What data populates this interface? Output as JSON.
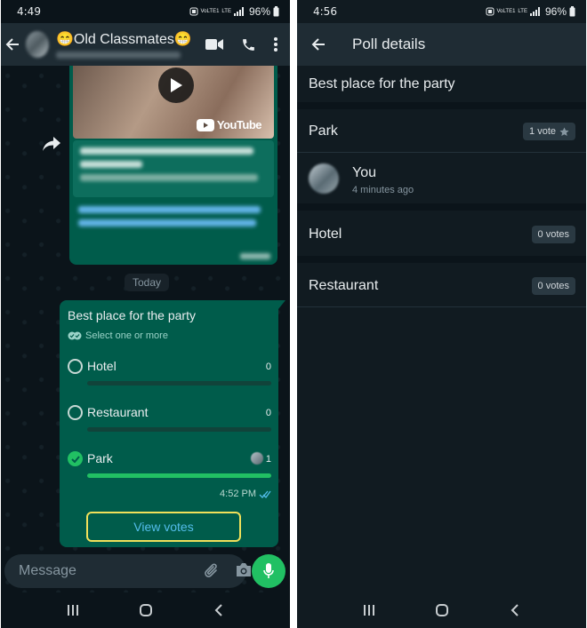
{
  "colors": {
    "accent": "#21c063",
    "bubble": "#005c4b",
    "link": "#53bdeb",
    "highlight": "#f1e05a"
  },
  "left": {
    "status": {
      "time": "4:49",
      "net1": "VoLTE1",
      "net2": "LTE",
      "battery": "96%"
    },
    "header": {
      "title": "😁Old Classmates😁",
      "icons": [
        "back-arrow-icon",
        "video-call-icon",
        "phone-icon",
        "more-vert-icon"
      ]
    },
    "video": {
      "source": "YouTube"
    },
    "date_chip": "Today",
    "poll": {
      "question": "Best place for the party",
      "hint": "Select one or more",
      "options": [
        {
          "label": "Hotel",
          "count": "0",
          "selected": false,
          "fill": 0
        },
        {
          "label": "Restaurant",
          "count": "0",
          "selected": false,
          "fill": 0
        },
        {
          "label": "Park",
          "count": "1",
          "selected": true,
          "fill": 1
        }
      ],
      "time": "4:52 PM",
      "view_votes": "View votes"
    },
    "composer": {
      "placeholder": "Message",
      "icons": [
        "emoji-icon",
        "attach-icon",
        "camera-icon",
        "mic-icon"
      ]
    }
  },
  "right": {
    "status": {
      "time": "4:56",
      "net1": "VoLTE1",
      "net2": "LTE",
      "battery": "96%"
    },
    "header": {
      "title": "Poll details"
    },
    "question": "Best place for the party",
    "options": [
      {
        "name": "Park",
        "votes": "1 vote",
        "voters": [
          {
            "name": "You",
            "time": "4 minutes ago"
          }
        ]
      },
      {
        "name": "Hotel",
        "votes": "0 votes"
      },
      {
        "name": "Restaurant",
        "votes": "0 votes"
      }
    ]
  }
}
